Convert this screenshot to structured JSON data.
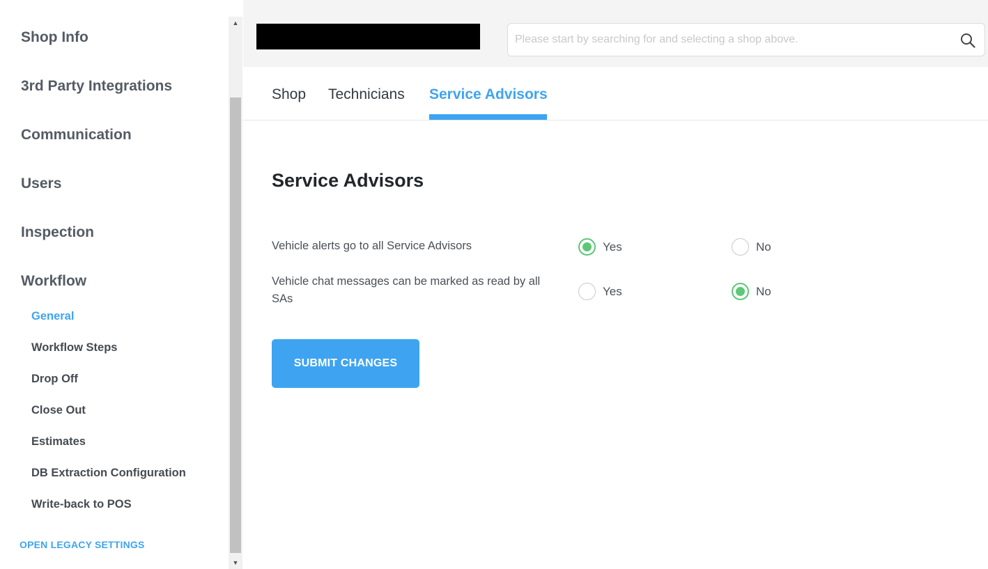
{
  "sidebar": {
    "sections": [
      {
        "label": "Shop Info"
      },
      {
        "label": "3rd Party Integrations"
      },
      {
        "label": "Communication"
      },
      {
        "label": "Users"
      },
      {
        "label": "Inspection"
      },
      {
        "label": "Workflow"
      }
    ],
    "workflow_items": [
      {
        "label": "General",
        "active": true
      },
      {
        "label": "Workflow Steps"
      },
      {
        "label": "Drop Off"
      },
      {
        "label": "Close Out"
      },
      {
        "label": "Estimates"
      },
      {
        "label": "DB Extraction Configuration"
      },
      {
        "label": "Write-back to POS"
      }
    ],
    "legacy_link": "OPEN LEGACY SETTINGS"
  },
  "search": {
    "placeholder": "Please start by searching for and selecting a shop above.",
    "icon": "search-icon"
  },
  "tabs": [
    {
      "label": "Shop"
    },
    {
      "label": "Technicians"
    },
    {
      "label": "Service Advisors",
      "active": true
    }
  ],
  "main": {
    "title": "Service Advisors",
    "settings": [
      {
        "label": "Vehicle alerts go to all Service Advisors",
        "options": [
          {
            "label": "Yes",
            "checked": true
          },
          {
            "label": "No",
            "checked": false
          }
        ]
      },
      {
        "label": "Vehicle chat messages can be marked as read by all SAs",
        "options": [
          {
            "label": "Yes",
            "checked": false
          },
          {
            "label": "No",
            "checked": true
          }
        ]
      }
    ],
    "submit_label": "SUBMIT CHANGES"
  },
  "colors": {
    "accent": "#3ea4f1",
    "radio_checked": "#5cc877"
  }
}
